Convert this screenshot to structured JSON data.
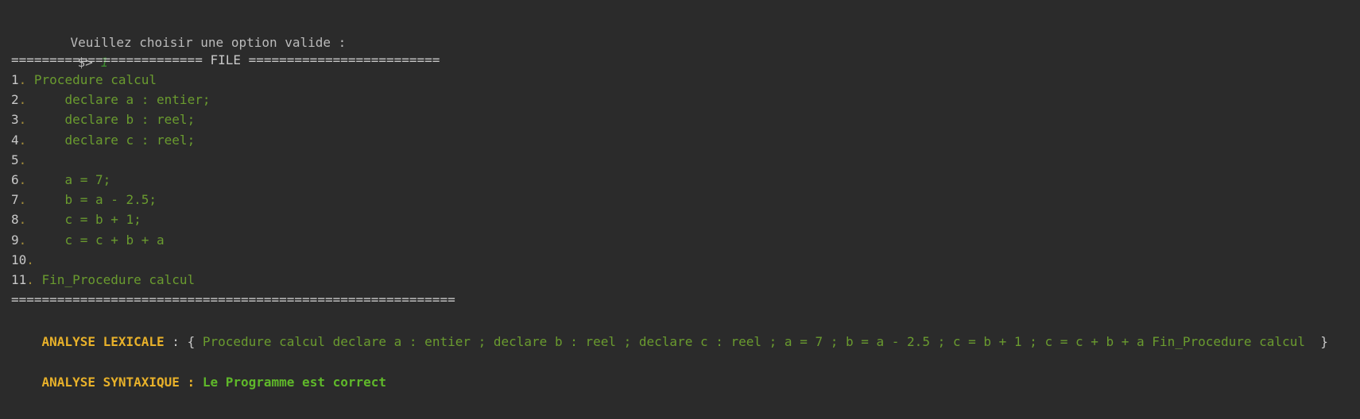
{
  "prompt": {
    "message": "Veuillez choisir une option valide :",
    "cursor": "$>",
    "input": "1"
  },
  "file_header": "========================= FILE =========================",
  "file_lines": [
    {
      "num": "1",
      "text": "Procedure calcul"
    },
    {
      "num": "2",
      "text": "    declare a : entier;"
    },
    {
      "num": "3",
      "text": "    declare b : reel;"
    },
    {
      "num": "4",
      "text": "    declare c : reel;"
    },
    {
      "num": "5",
      "text": ""
    },
    {
      "num": "6",
      "text": "    a = 7;"
    },
    {
      "num": "7",
      "text": "    b = a - 2.5;"
    },
    {
      "num": "8",
      "text": "    c = b + 1;"
    },
    {
      "num": "9",
      "text": "    c = c + b + a"
    },
    {
      "num": "10",
      "text": ""
    },
    {
      "num": "11",
      "text": "Fin_Procedure calcul"
    }
  ],
  "file_footer": "==========================================================",
  "lexical": {
    "label": "ANALYSE LEXICALE",
    "sep": " : ",
    "open": "{ ",
    "tokens": "Procedure calcul declare a : entier ; declare b : reel ; declare c : reel ; a = 7 ; b = a - 2.5 ; c = b + 1 ; c = c + b + a Fin_Procedure calcul ",
    "close": " }"
  },
  "syntax": {
    "label": "ANALYSE SYNTAXIQUE : ",
    "result": "Le Programme est correct"
  },
  "colors": {
    "background": "#2b2b2b",
    "code_green": "#6a9b2f",
    "label_yellow": "#e8b12a",
    "result_green": "#5fb82a"
  }
}
